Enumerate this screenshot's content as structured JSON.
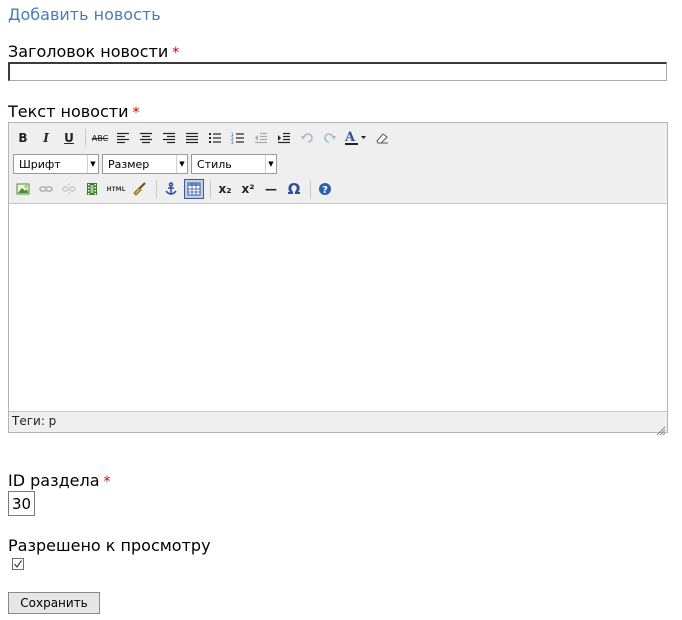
{
  "page": {
    "title": "Добавить новость"
  },
  "form": {
    "required_mark": "*",
    "news_title": {
      "label": "Заголовок новости",
      "value": ""
    },
    "news_text": {
      "label": "Текст новости"
    },
    "section_id": {
      "label": "ID раздела",
      "value": "30"
    },
    "allowed": {
      "label": "Разрешено к просмотру",
      "checked": true
    },
    "submit_label": "Сохранить"
  },
  "editor": {
    "toolbar": {
      "bold": "B",
      "italic": "I",
      "underline": "U",
      "strike": "ABC",
      "html": "HTML",
      "subscript": "x₂",
      "superscript": "x²",
      "hr": "—",
      "omega": "Ω",
      "font_label": "Шрифт",
      "size_label": "Размер",
      "style_label": "Стиль"
    },
    "status": "Теги: p"
  },
  "colors": {
    "title": "#4a7cba",
    "required": "#cc0000",
    "active_button": "#c2d0e6"
  }
}
